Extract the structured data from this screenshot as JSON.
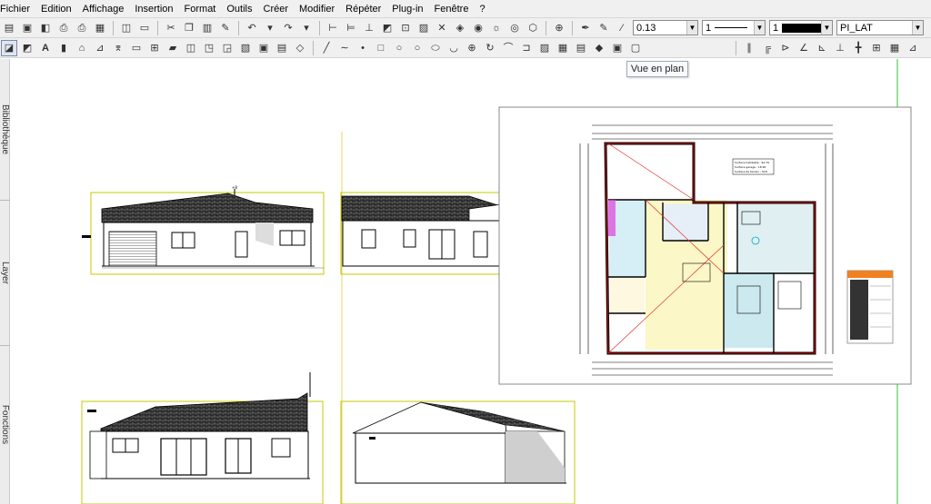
{
  "menu": [
    "Fichier",
    "Edition",
    "Affichage",
    "Insertion",
    "Format",
    "Outils",
    "Créer",
    "Modifier",
    "Répéter",
    "Plug-in",
    "Fenêtre",
    "?"
  ],
  "toolbar": {
    "line_weight": "0.13",
    "line_type": "1",
    "pen_color": "1",
    "layer": "PI_LAT"
  },
  "tooltip": "Vue en plan",
  "side_tabs": [
    "Bibliothèque",
    "Layer",
    "Fonctions"
  ],
  "plan": {
    "notes": [
      "Surface habitable : 94.79",
      "Surface garage : 18.90",
      "Surface de terrain : 518"
    ]
  }
}
